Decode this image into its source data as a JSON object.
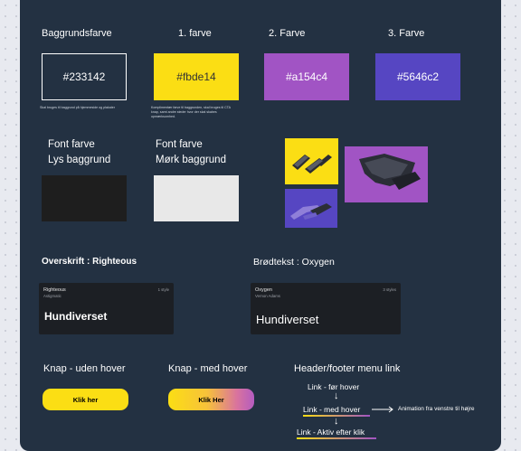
{
  "colors": {
    "background": "#233142",
    "yellow": "#fbde14",
    "magenta": "#a154c4",
    "violet": "#5646c2"
  },
  "palette": {
    "headers": [
      "Baggrundsfarve",
      "1. farve",
      "2. Farve",
      "3. Farve"
    ],
    "swatches": [
      "#233142",
      "#fbde14",
      "#a154c4",
      "#5646c2"
    ],
    "note_background": "Skal bruges til baggrund på hjemmeside og plakater",
    "note_primary": "Komplimentær farve til baggrunden, skal bruges til CTA knap, samt andre steder hvor der skal skabes opmærksomhed."
  },
  "font_colors": {
    "light_title": "Font farve",
    "light_subtitle": "Lys baggrund",
    "dark_title": "Font farve",
    "dark_subtitle": "Mørk baggrund"
  },
  "typography": {
    "heading_label": "Overskrift : Righteous",
    "body_label": "Brødtekst : Oxygen",
    "heading_card": {
      "name": "Righteous",
      "designer": "Astigmatic",
      "styles": "1 style",
      "sample": "Hundiverset"
    },
    "body_card": {
      "name": "Oxygen",
      "designer": "Vernon Adams",
      "styles": "3 styles",
      "sample": "Hundiverset"
    }
  },
  "buttons": {
    "no_hover_label": "Knap - uden hover",
    "hover_label": "Knap - med hover",
    "no_hover_text": "Klik her",
    "hover_text": "Klik Her"
  },
  "menu": {
    "title": "Header/footer menu link",
    "before_hover": "Link - før hover",
    "with_hover": "Link - med hover",
    "active": "Link - Aktiv efter klik",
    "animation_note": "Animation fra venstre til højre"
  }
}
